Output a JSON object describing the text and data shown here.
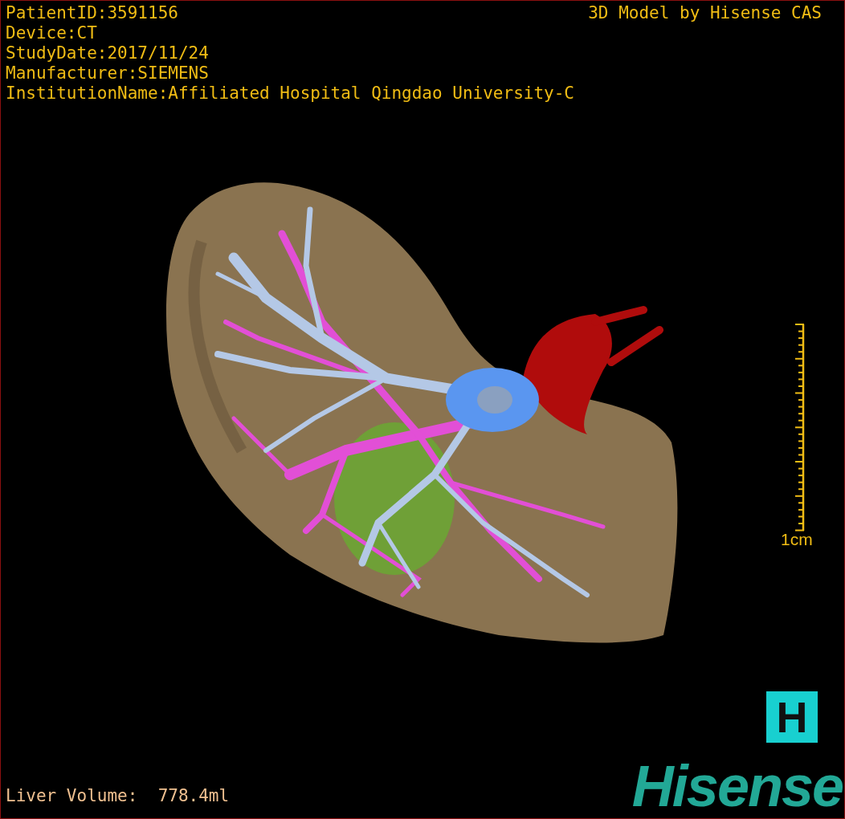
{
  "info_lines": [
    "PatientID:3591156",
    "Device:CT",
    "StudyDate:2017/11/24",
    "Manufacturer:SIEMENS",
    "InstitutionName:Affiliated Hospital Qingdao University-C"
  ],
  "model_credit": "3D Model by Hisense CAS",
  "scale_bar": {
    "label": "1cm"
  },
  "volume": "Liver Volume:  778.4ml",
  "logo_badge": "H",
  "logo_text": "Hisense"
}
